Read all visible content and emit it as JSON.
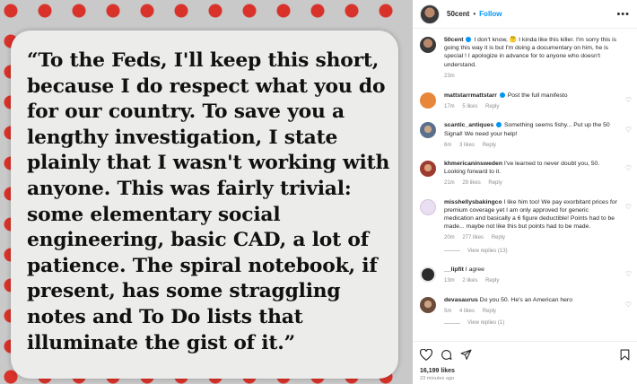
{
  "post": {
    "image_quote": "“To the Feds, I'll keep this short, because I do respect what you do for our country. To save you a lengthy investigation, I state plainly that I wasn't working with anyone. This was fairly trivial: some elementary social engineering, basic CAD, a lot of patience. The spiral notebook, if present, has some straggling notes and To Do lists that illuminate the gist of it.”"
  },
  "header": {
    "username": "50cent",
    "separator": "•",
    "follow_label": "Follow",
    "more_label": "•••"
  },
  "comments": [
    {
      "user": "50cent",
      "verified": true,
      "text": "I don't know, 🤔 I kinda like this killer. I'm sorry this is going this way it is but I'm doing a documentary on him, he is special ! I apologize in advance for to anyone who doesn't understand.",
      "time": "23m",
      "likes": "",
      "reply": "",
      "avatar_color": "#7a5a48"
    },
    {
      "user": "mattstarrmattstarr",
      "verified": true,
      "text": "Post the full manifesto",
      "time": "17m",
      "likes": "5 likes",
      "reply": "Reply",
      "avatar_color": "#e8873a"
    },
    {
      "user": "scantic_antiques",
      "verified": true,
      "text": "Something seems fishy... Put up the 50 Signal! We need your help!",
      "time": "6m",
      "likes": "3 likes",
      "reply": "Reply",
      "avatar_color": "#5a6f8c"
    },
    {
      "user": "khmericaninsweden",
      "verified": false,
      "text": "I've learned to never doubt you, 50. Looking forward to it.",
      "time": "21m",
      "likes": "29 likes",
      "reply": "Reply",
      "avatar_color": "#9c3b2f"
    },
    {
      "user": "misshellysbakingco",
      "verified": false,
      "text": "I like him too! We pay exorbitant prices for premium coverage yet I am only approved for generic medication and basically a 6 figure deductible! Points had to be made... maybe not like this but points had to be made.",
      "time": "20m",
      "likes": "277 likes",
      "reply": "Reply",
      "avatar_color": "#e9dff0",
      "view_replies": "View replies (13)"
    },
    {
      "user": "__lipfit",
      "verified": false,
      "text": "I agree",
      "time": "13m",
      "likes": "2 likes",
      "reply": "Reply",
      "avatar_color": "#2b2b2b"
    },
    {
      "user": "devasaurus",
      "verified": false,
      "text": "Do you 50. He's an American hero",
      "time": "5m",
      "likes": "4 likes",
      "reply": "Reply",
      "avatar_color": "#6b4c3b",
      "view_replies": "View replies (1)"
    }
  ],
  "actions": {
    "likes": "16,199 likes",
    "time": "23 minutes ago"
  },
  "colors": {
    "link_blue": "#0095f6",
    "muted": "#8e8e8e",
    "text": "#262626"
  }
}
